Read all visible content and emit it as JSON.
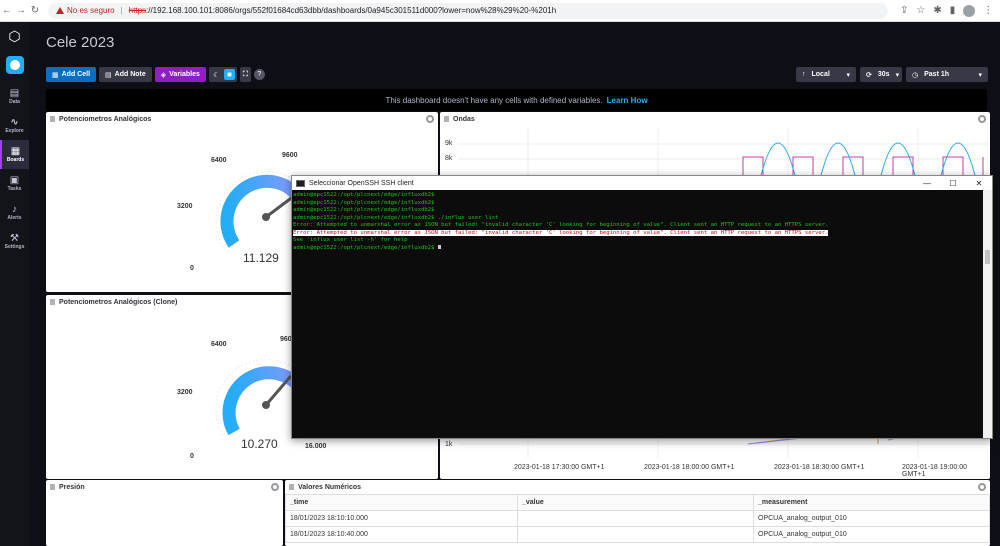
{
  "browser": {
    "security_warning": "No es seguro",
    "url_scheme": "https",
    "url_rest": "://192.168.100.101:8086/orgs/552f01684cd63dbb/dashboards/0a945c301511d000?lower=now%28%29%20-%201h"
  },
  "nav": {
    "items": [
      {
        "label": "Data",
        "icon": "database-icon"
      },
      {
        "label": "Explore",
        "icon": "graph-line-icon"
      },
      {
        "label": "Boards",
        "icon": "dashboards-icon"
      },
      {
        "label": "Tasks",
        "icon": "calendar-icon"
      },
      {
        "label": "Alerts",
        "icon": "bell-icon"
      },
      {
        "label": "Settings",
        "icon": "wrench-icon"
      }
    ]
  },
  "dashboard": {
    "title": "Cele 2023",
    "add_cell": "Add Cell",
    "add_note": "Add Note",
    "variables": "Variables",
    "timezone": "Local",
    "refresh": "30s",
    "range": "Past 1h",
    "banner_text": "This dashboard doesn't have any cells with defined variables.",
    "banner_link": "Learn How"
  },
  "cells": {
    "gauge1": {
      "title": "Potenciometros Analógicos",
      "ticks": [
        "0",
        "3200",
        "6400",
        "9600"
      ],
      "value": "11.129",
      "value_number": 11129,
      "max_number": 16000,
      "colors": [
        "#22adf6",
        "#9394ff"
      ]
    },
    "gauge2": {
      "title": "Potenciometros Analógicos (Clone)",
      "ticks": [
        "0",
        "3200",
        "6400",
        "9600",
        "16.000"
      ],
      "value": "10.270",
      "value_number": 10270,
      "max_number": 16000
    },
    "ondas": {
      "title": "Ondas",
      "y_ticks": [
        "9k",
        "8k",
        "1k"
      ],
      "x_ticks": [
        "2023-01-18 17:30:00 GMT+1",
        "2023-01-18 18:00:00 GMT+1",
        "2023-01-18 18:30:00 GMT+1",
        "2023-01-18 19:00:00 GMT+1"
      ],
      "colors": [
        "#22adf6",
        "#bf3fb2",
        "#9394ff",
        "#f48d38"
      ]
    },
    "presion": {
      "title": "Presión"
    },
    "valores": {
      "title": "Valores Numéricos",
      "columns": [
        "_time",
        "_value",
        "_measurement"
      ],
      "rows": [
        [
          "18/01/2023 18:10:10.000",
          "",
          "OPCUA_analog_output_010"
        ],
        [
          "18/01/2023 18:10:40.000",
          "",
          "OPCUA_analog_output_010"
        ]
      ]
    }
  },
  "ssh": {
    "title": "Seleccionar OpenSSH SSH client",
    "lines": [
      {
        "kind": "prompt",
        "text": "admin@epc1522:/opt/plcnext/edge/influxdb2$"
      },
      {
        "kind": "prompt",
        "text": "admin@epc1522:/opt/plcnext/edge/influxdb2$"
      },
      {
        "kind": "prompt",
        "text": "admin@epc1522:/opt/plcnext/edge/influxdb2$"
      },
      {
        "kind": "prompt",
        "text": "admin@epc1522:/opt/plcnext/edge/influxdb2$ ./influx user list"
      },
      {
        "kind": "err",
        "text": "Error: Attempted to unmarshal error as JSON but failed: \"invalid character 'C' looking for beginning of value\". Client sent an HTTP request to an HTTPS server."
      },
      {
        "kind": "errsel",
        "text": "Error: Attempted to unmarshal error as JSON but failed: \"invalid character 'C' looking for beginning of value\". Client sent an HTTP request to an HTTPS server."
      },
      {
        "kind": "err",
        "text": "See 'influx user list -h' for help"
      },
      {
        "kind": "prompt",
        "text": "admin@epc1522:/opt/plcnext/edge/influxdb2$"
      }
    ]
  }
}
